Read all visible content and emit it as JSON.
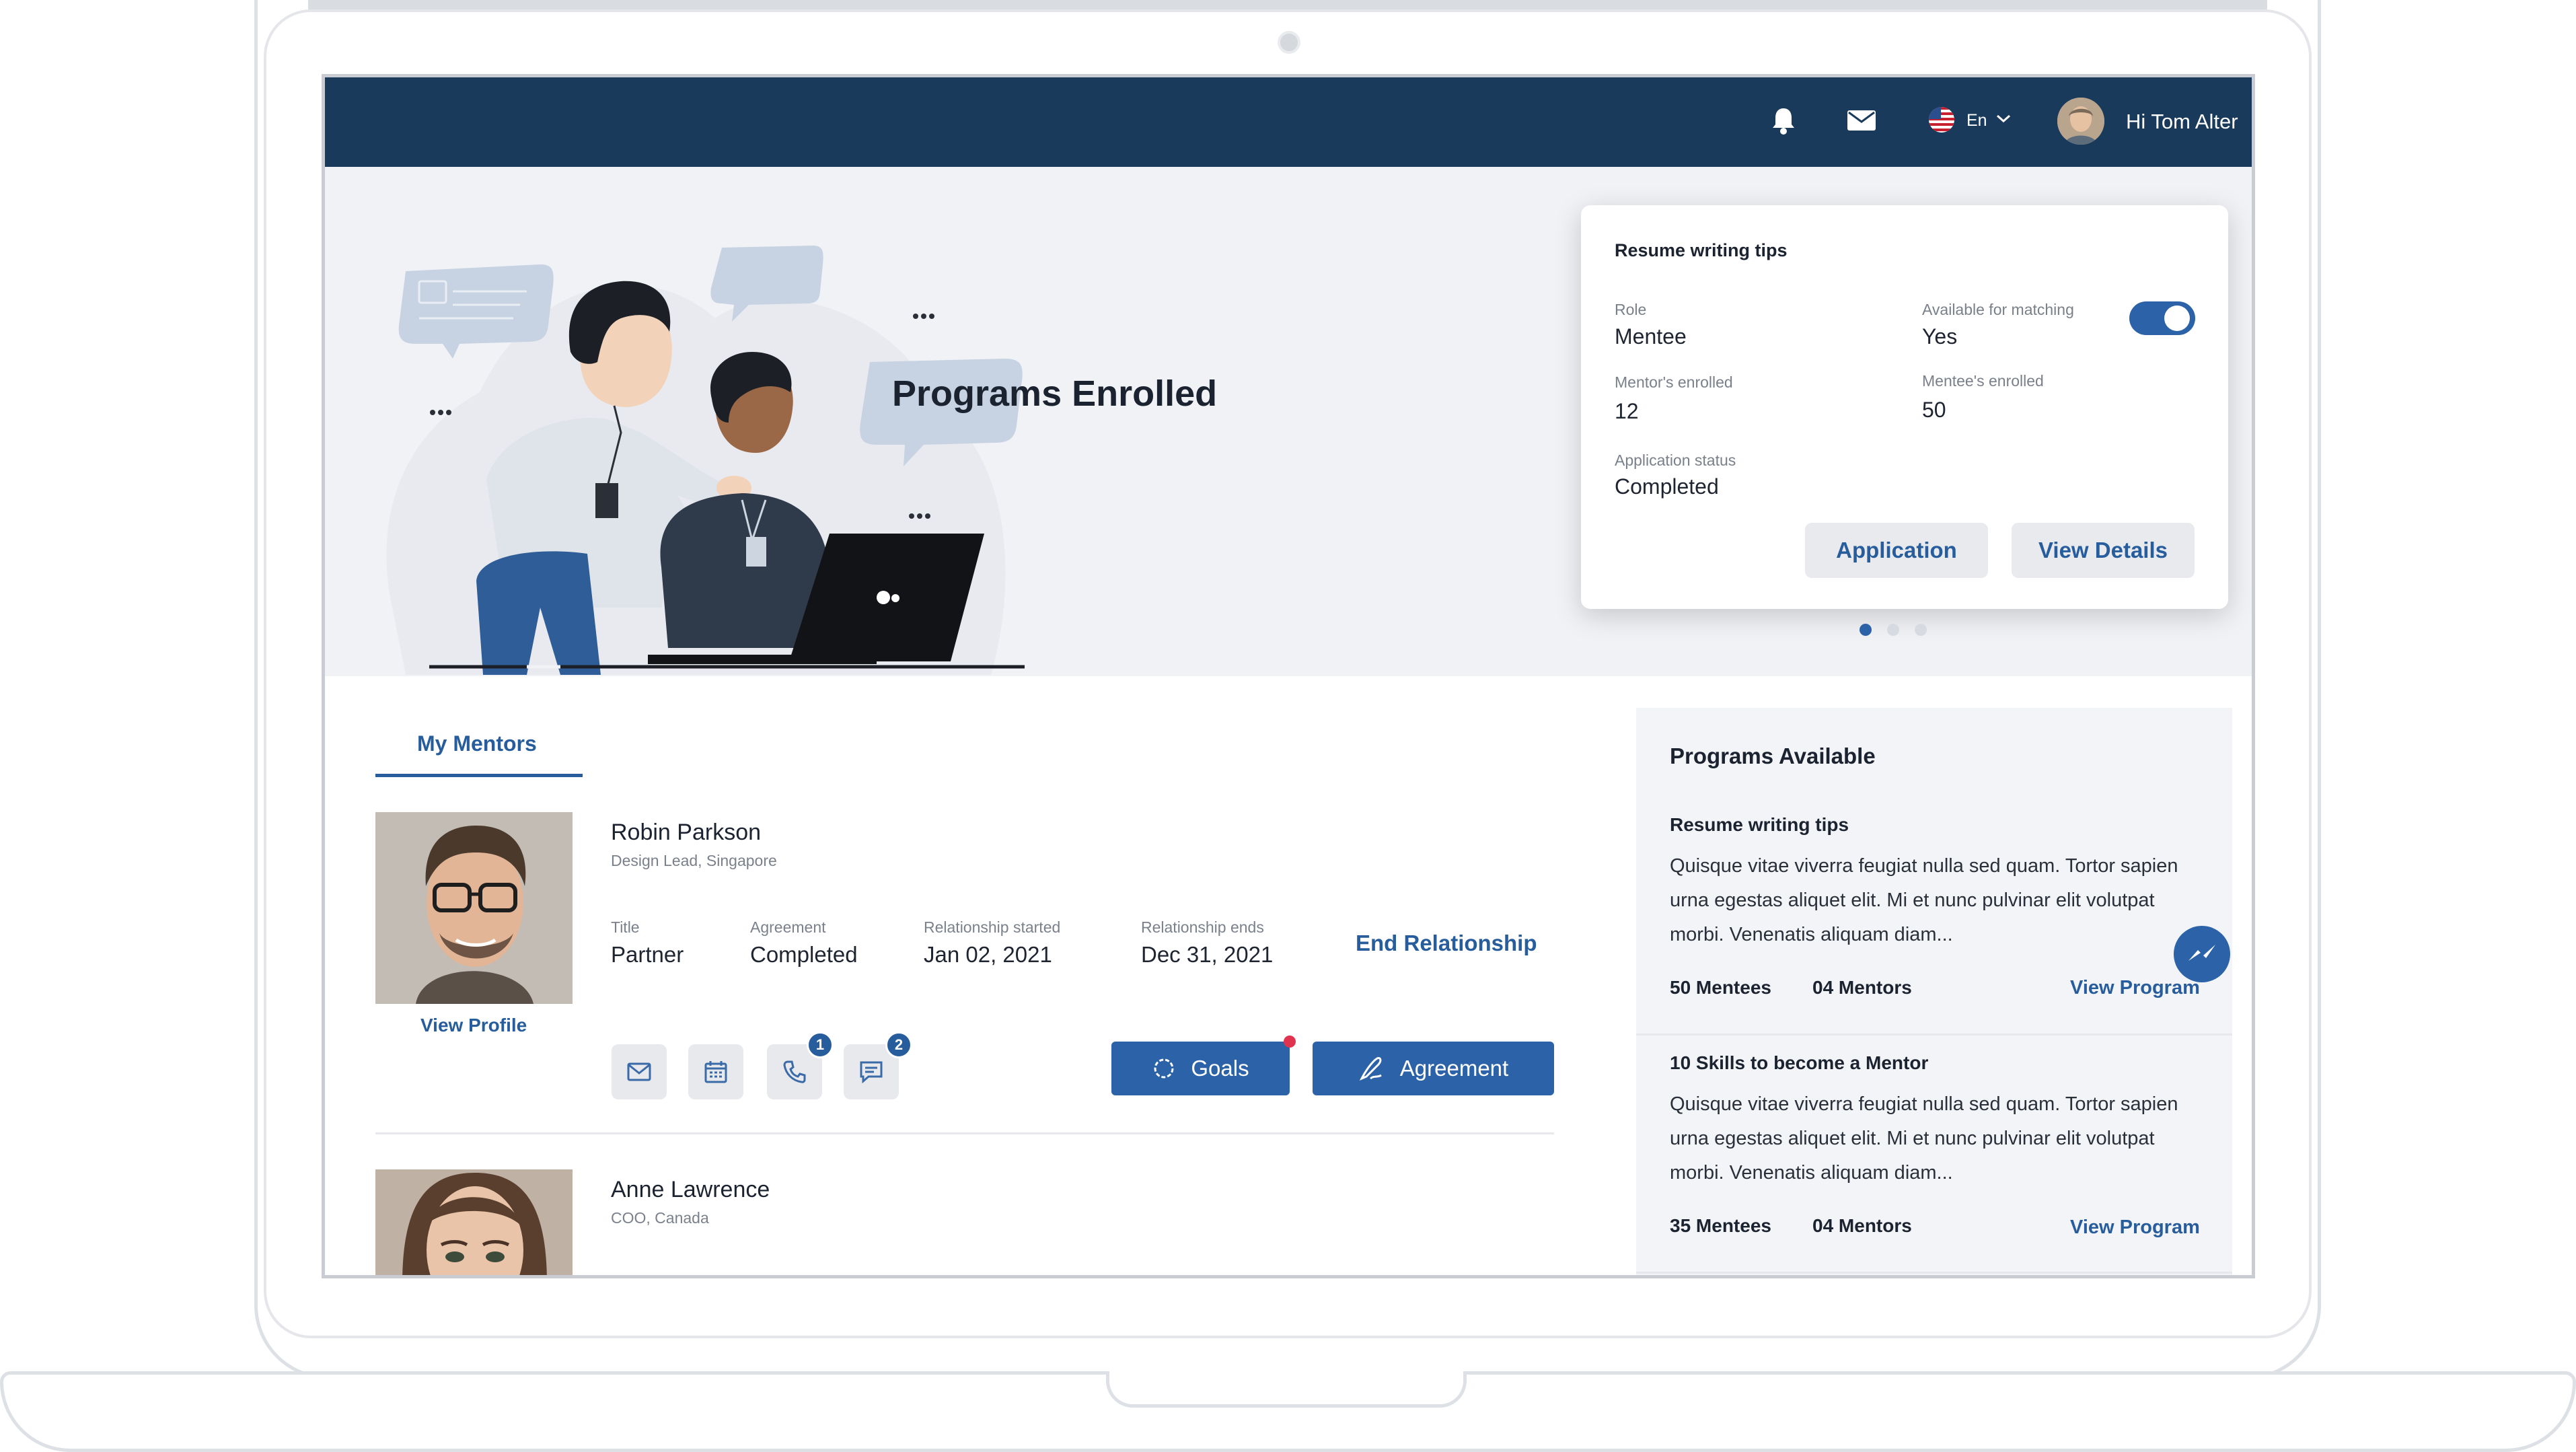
{
  "header": {
    "language": "En",
    "greeting": "Hi Tom Alter",
    "icons": [
      "bell-icon",
      "mail-icon",
      "us-flag-icon",
      "chevron-down-icon"
    ]
  },
  "hero": {
    "title": "Programs Enrolled"
  },
  "program_card": {
    "title": "Resume writing tips",
    "role_label": "Role",
    "role_value": "Mentee",
    "matching_label": "Available for matching",
    "matching_value": "Yes",
    "matching_enabled": true,
    "mentors_label": "Mentor's enrolled",
    "mentors_value": "12",
    "mentees_label": "Mentee's enrolled",
    "mentees_value": "50",
    "status_label": "Application status",
    "status_value": "Completed",
    "application_button": "Application",
    "details_button": "View Details",
    "carousel_active_index": 0,
    "carousel_count": 3
  },
  "mentors": {
    "tab_label": "My Mentors",
    "items": [
      {
        "name": "Robin Parkson",
        "subtitle": "Design Lead, Singapore",
        "view_profile": "View Profile",
        "title_label": "Title",
        "title_value": "Partner",
        "agreement_label": "Agreement",
        "agreement_value": "Completed",
        "started_label": "Relationship started",
        "started_value": "Jan 02, 2021",
        "ends_label": "Relationship ends",
        "ends_value": "Dec 31, 2021",
        "end_link": "End Relationship",
        "call_badge": "1",
        "chat_badge": "2",
        "goals_button": "Goals",
        "agreement_button": "Agreement"
      },
      {
        "name": "Anne Lawrence",
        "subtitle": "COO, Canada"
      }
    ]
  },
  "programs_available": {
    "title": "Programs Available",
    "items": [
      {
        "name": "Resume writing tips",
        "description": "Quisque vitae viverra feugiat nulla sed quam. Tortor sapien urna egestas aliquet elit. Mi et nunc pulvinar elit volutpat morbi. Venenatis aliquam diam...",
        "mentees": "50 Mentees",
        "mentors": "04 Mentors",
        "link": "View Program"
      },
      {
        "name": "10 Skills to become a Mentor",
        "description": "Quisque vitae viverra feugiat nulla sed quam. Tortor sapien urna egestas aliquet elit. Mi et nunc pulvinar elit volutpat morbi. Venenatis aliquam diam...",
        "mentees": "35 Mentees",
        "mentors": "04 Mentors",
        "link": "View Program"
      }
    ]
  },
  "colors": {
    "header_bg": "#1a3a5c",
    "accent": "#275d9c",
    "button": "#2b62a8",
    "notification_dot": "#e0334f"
  }
}
